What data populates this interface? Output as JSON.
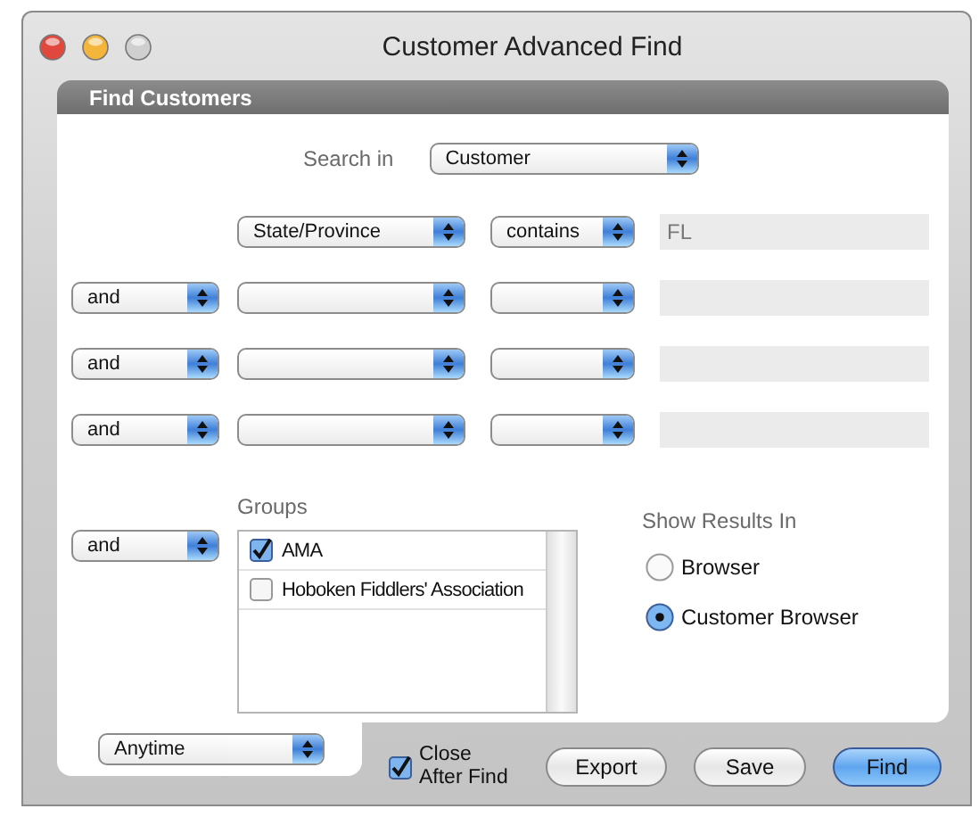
{
  "window": {
    "title": "Customer Advanced Find"
  },
  "panel": {
    "title": "Find Customers"
  },
  "search_in": {
    "label": "Search in",
    "value": "Customer"
  },
  "criteria": [
    {
      "field": "State/Province",
      "operator": "contains",
      "value": "FL"
    },
    {
      "conjunction": "and"
    },
    {
      "conjunction": "and"
    },
    {
      "conjunction": "and"
    }
  ],
  "groups": {
    "conjunction": "and",
    "label": "Groups",
    "items": [
      {
        "label": "AMA",
        "checked": true
      },
      {
        "label": "Hoboken Fiddlers' Association",
        "checked": false
      }
    ]
  },
  "show_results": {
    "label": "Show Results In",
    "options": [
      {
        "label": "Browser",
        "selected": false
      },
      {
        "label": "Customer Browser",
        "selected": true
      }
    ]
  },
  "date_range": "Anytime",
  "close_after_find": {
    "label": "Close After Find",
    "checked": true
  },
  "buttons": [
    {
      "label": "Export",
      "default": false
    },
    {
      "label": "Save",
      "default": false
    },
    {
      "label": "Find",
      "default": true
    }
  ]
}
